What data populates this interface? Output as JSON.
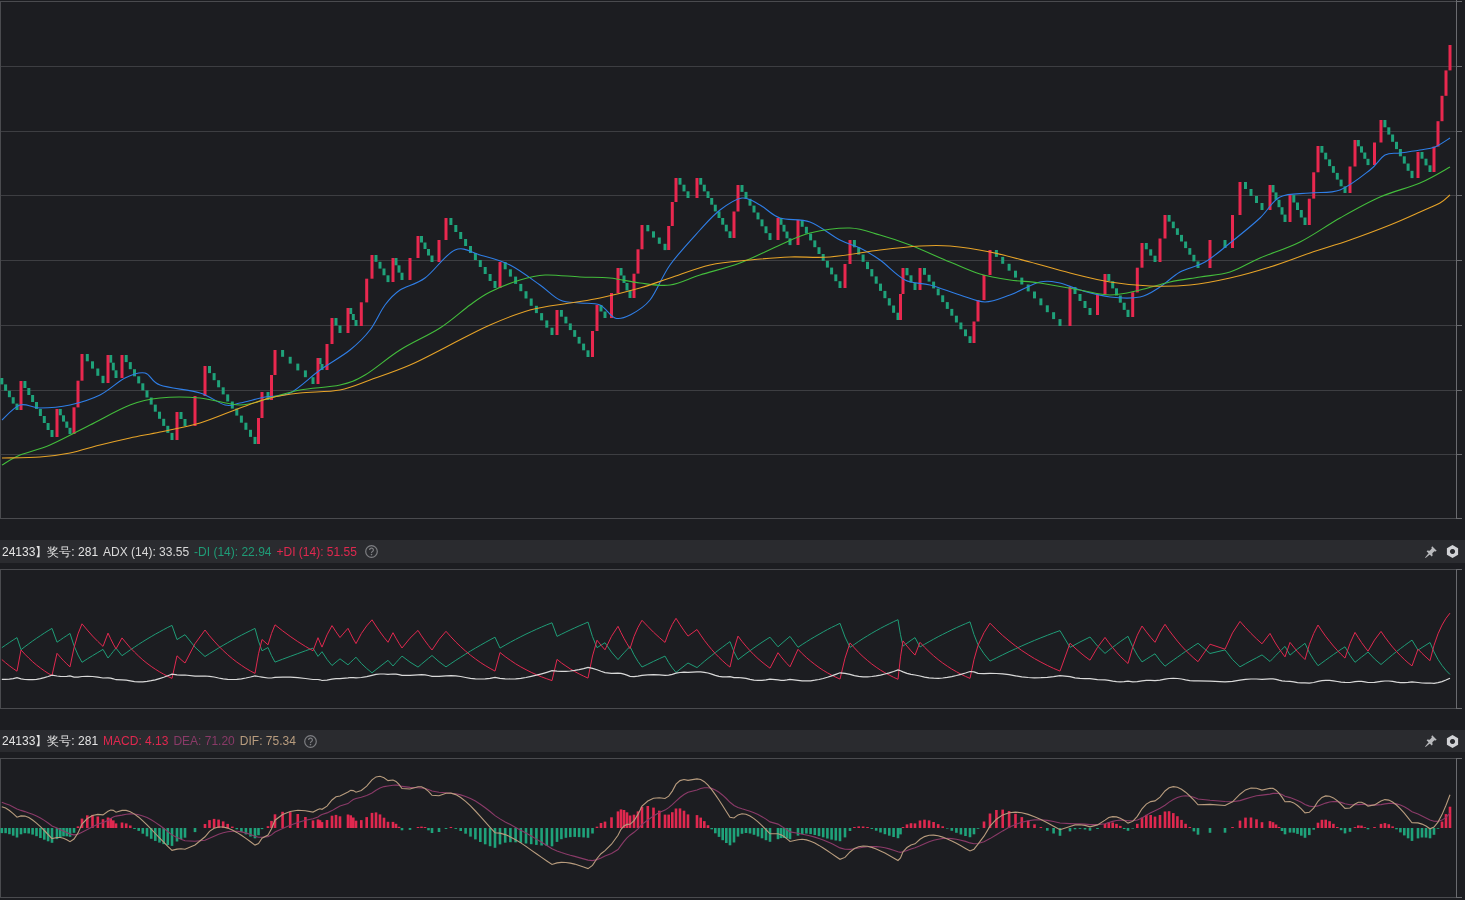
{
  "adx_panel": {
    "title": "24133】奖号: 281",
    "legend": [
      {
        "label": "ADX (14): 33.55",
        "color": "#d9d9d9"
      },
      {
        "label": "-DI (14): 22.94",
        "color": "#1f9c77"
      },
      {
        "label": "+DI (14): 51.55",
        "color": "#e0284f"
      }
    ]
  },
  "macd_panel": {
    "title": "24133】奖号: 281",
    "legend": [
      {
        "label": "MACD: 4.13",
        "color": "#e0284f"
      },
      {
        "label": "DEA: 71.20",
        "color": "#8a3a68"
      },
      {
        "label": "DIF: 75.34",
        "color": "#b89c7e"
      }
    ]
  }
}
